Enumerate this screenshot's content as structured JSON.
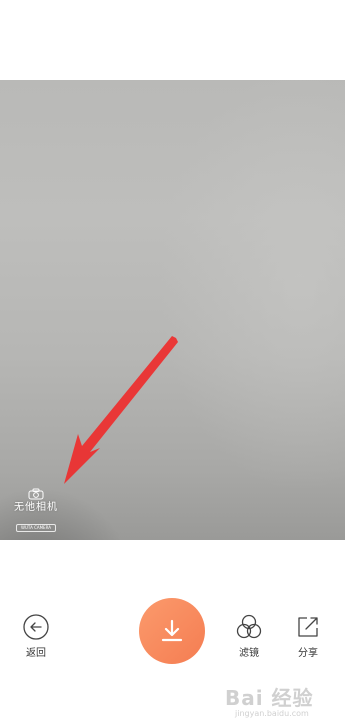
{
  "watermark": {
    "title": "无他相机",
    "subtitle": "WUTA CAMERA"
  },
  "toolbar": {
    "back_label": "返回",
    "filter_label": "滤镜",
    "share_label": "分享"
  },
  "site_watermark": {
    "logo": "Bai 经验",
    "url": "jingyan.baidu.com"
  },
  "colors": {
    "download_button": "#f7875b",
    "arrow": "#ee2d2d"
  }
}
